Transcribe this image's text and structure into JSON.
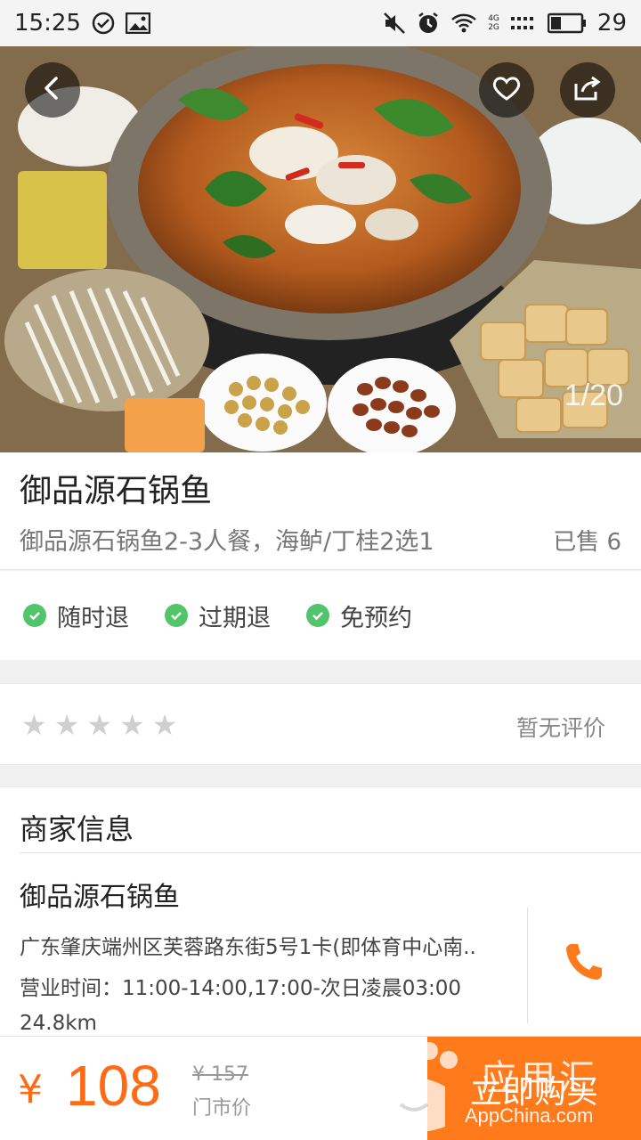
{
  "status_bar": {
    "time": "15:25",
    "battery": "29",
    "net_4g": "4G",
    "net_2g": "2G"
  },
  "hero": {
    "counter": "1/20"
  },
  "product": {
    "title": "御品源石锅鱼",
    "subtitle": "御品源石锅鱼2-3人餐，海鲈/丁桂2选1",
    "sold": "已售 6"
  },
  "guarantees": [
    {
      "label": "随时退"
    },
    {
      "label": "过期退"
    },
    {
      "label": "免预约"
    }
  ],
  "rating": {
    "stars": 0,
    "no_review": "暂无评价"
  },
  "merchant": {
    "header": "商家信息",
    "name": "御品源石锅鱼",
    "address": "广东肇庆端州区芙蓉路东街5号1卡(即体育中心南..",
    "hours": "营业时间：11:00-14:00,17:00-次日凌晨03:00",
    "distance": "24.8km"
  },
  "bottom": {
    "currency": "¥",
    "price": "108",
    "original_price": "¥ 157",
    "original_label": "门市价",
    "buy_label": "立即购买"
  },
  "watermark": {
    "text": "应用汇",
    "sub": "AppChina.com"
  },
  "colors": {
    "accent": "#ff7a1a",
    "price": "#ff6a14",
    "check": "#52c46a"
  }
}
